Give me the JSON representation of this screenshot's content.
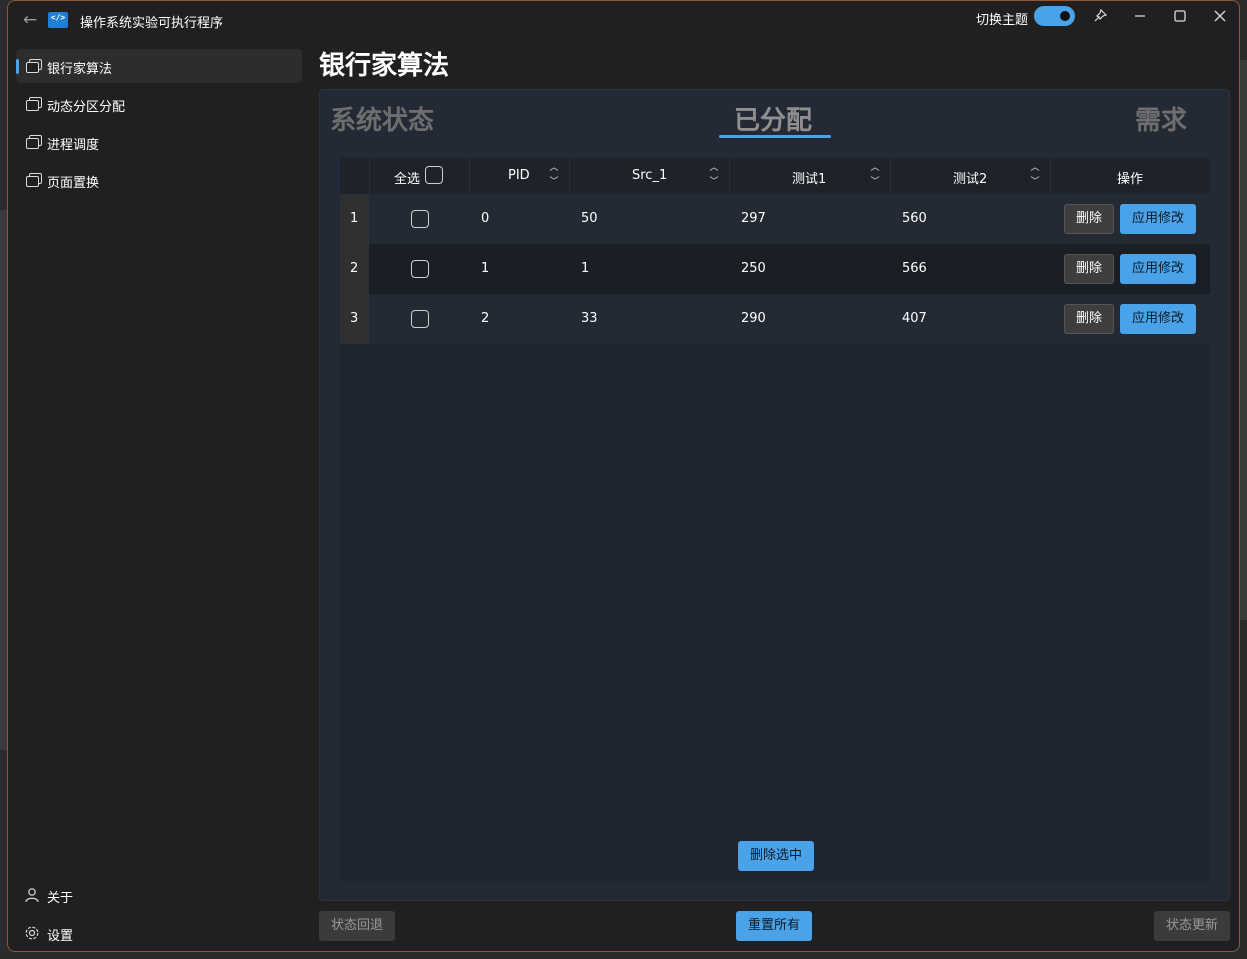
{
  "titlebar": {
    "title": "操作系统实验可执行程序",
    "theme_toggle_label": "切换主题",
    "theme_toggle_on": true
  },
  "sidebar": {
    "items": [
      {
        "label": "银行家算法",
        "selected": true
      },
      {
        "label": "动态分区分配",
        "selected": false
      },
      {
        "label": "进程调度",
        "selected": false
      },
      {
        "label": "页面置换",
        "selected": false
      }
    ],
    "footer": [
      {
        "label": "关于",
        "icon": "person-icon"
      },
      {
        "label": "设置",
        "icon": "gear-icon"
      }
    ]
  },
  "main": {
    "page_title": "银行家算法",
    "tabs": [
      {
        "label": "系统状态",
        "active": false
      },
      {
        "label": "已分配",
        "active": true
      },
      {
        "label": "需求",
        "active": false
      }
    ],
    "table": {
      "select_all_label": "全选",
      "columns": [
        "PID",
        "Src_1",
        "测试1",
        "测试2",
        "操作"
      ],
      "rows": [
        {
          "index": "1",
          "pid": "0",
          "src_1": "50",
          "test1": "297",
          "test2": "560"
        },
        {
          "index": "2",
          "pid": "1",
          "src_1": "1",
          "test1": "250",
          "test2": "566"
        },
        {
          "index": "3",
          "pid": "2",
          "src_1": "33",
          "test1": "290",
          "test2": "407"
        }
      ],
      "delete_label": "删除",
      "apply_label": "应用修改",
      "delete_selected_label": "删除选中"
    },
    "footer_buttons": {
      "rollback": "状态回退",
      "reset_all": "重置所有",
      "update": "状态更新"
    }
  },
  "colors": {
    "accent": "#4aa3e8",
    "window_bg": "#202020",
    "panel_bg": "#232a35"
  }
}
